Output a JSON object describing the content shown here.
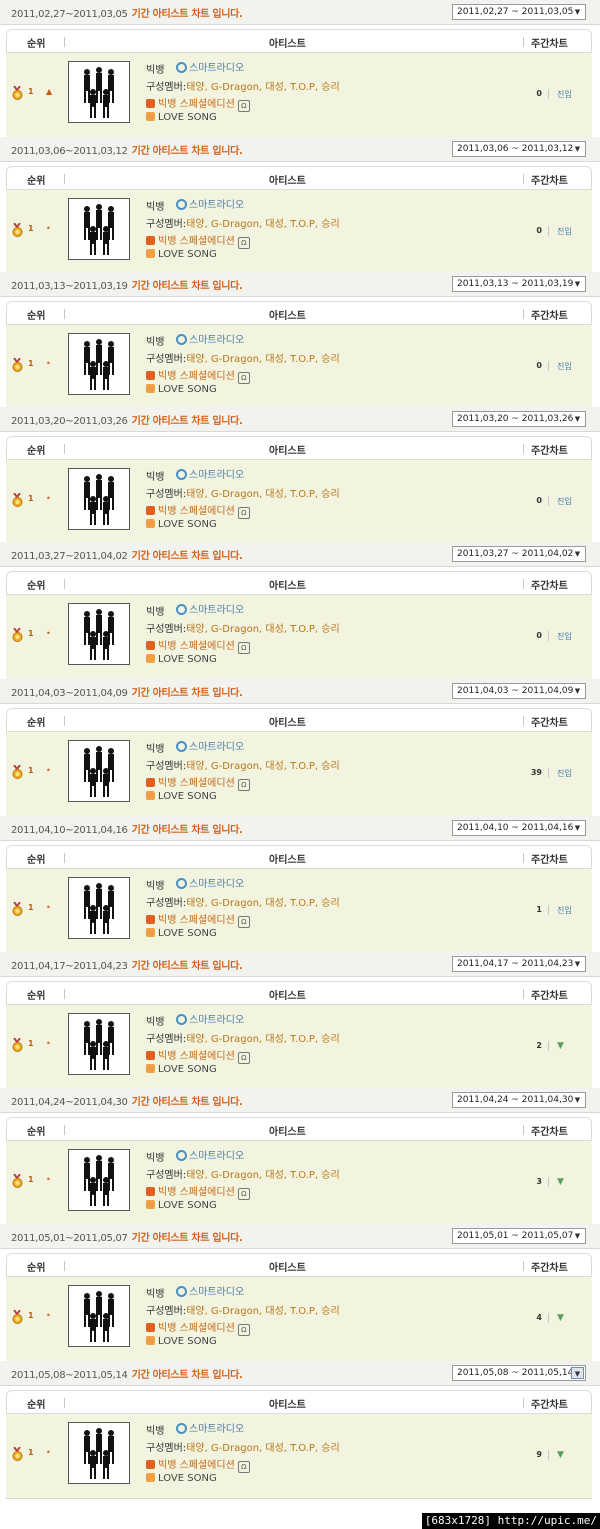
{
  "header": {
    "rank": "순위",
    "artist": "아티스트",
    "weekly": "주간차트"
  },
  "period_suffix": "기간 아티스트 차트 입니다.",
  "artist": {
    "name": "빅뱅",
    "radio_label": "스마트라디오",
    "members_prefix": "구성멤버:",
    "members": "태양, G-Dragon, 대성, T.O.P, 승리",
    "album": "빅뱅 스페셜에디션",
    "song": "LOVE SONG"
  },
  "icons": {
    "medal": "gold-medal-icon",
    "radio": "radio-icon",
    "listen": "headphones-icon",
    "rising": "up-arrow-icon",
    "falling": "down-arrow-icon"
  },
  "colors": {
    "accent": "#d0621a",
    "row_bg": "#f2f4e0",
    "link": "#3a7aa8"
  },
  "weeks": [
    {
      "period": "2011,02,27~2011,03,05",
      "select": "2011,02,27 ~ 2011,03,05",
      "rank": "1",
      "change": "up",
      "weekly": "0",
      "status": "진입"
    },
    {
      "period": "2011,03,06~2011,03,12",
      "select": "2011,03,06 ~ 2011,03,12",
      "rank": "1",
      "change": "same",
      "weekly": "0",
      "status": "진입"
    },
    {
      "period": "2011,03,13~2011,03,19",
      "select": "2011,03,13 ~ 2011,03,19",
      "rank": "1",
      "change": "same",
      "weekly": "0",
      "status": "진입"
    },
    {
      "period": "2011,03,20~2011,03,26",
      "select": "2011,03,20 ~ 2011,03,26",
      "rank": "1",
      "change": "same",
      "weekly": "0",
      "status": "진입"
    },
    {
      "period": "2011,03,27~2011,04,02",
      "select": "2011,03,27 ~ 2011,04,02",
      "rank": "1",
      "change": "same",
      "weekly": "0",
      "status": "진입"
    },
    {
      "period": "2011,04,03~2011,04,09",
      "select": "2011,04,03 ~ 2011,04,09",
      "rank": "1",
      "change": "same",
      "weekly": "39",
      "status": "진입"
    },
    {
      "period": "2011,04,10~2011,04,16",
      "select": "2011,04,10 ~ 2011,04,16",
      "rank": "1",
      "change": "same",
      "weekly": "1",
      "status": "진입"
    },
    {
      "period": "2011,04,17~2011,04,23",
      "select": "2011,04,17 ~ 2011,04,23",
      "rank": "1",
      "change": "same",
      "weekly": "2",
      "status": "down"
    },
    {
      "period": "2011,04,24~2011,04,30",
      "select": "2011,04,24 ~ 2011,04,30",
      "rank": "1",
      "change": "same",
      "weekly": "3",
      "status": "down"
    },
    {
      "period": "2011,05,01~2011,05,07",
      "select": "2011,05,01 ~ 2011,05,07",
      "rank": "1",
      "change": "same",
      "weekly": "4",
      "status": "down"
    },
    {
      "period": "2011,05,08~2011,05,14",
      "select": "2011,05,08 ~ 2011,05,14",
      "rank": "1",
      "change": "same",
      "weekly": "9",
      "status": "down"
    }
  ],
  "watermark": "[683x1728] http://upic.me/"
}
